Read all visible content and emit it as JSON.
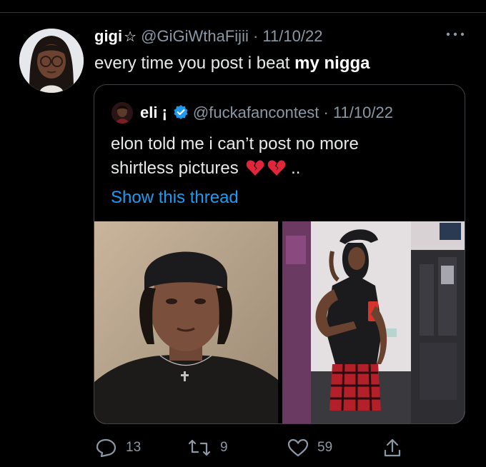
{
  "tweet": {
    "display_name": "gigi",
    "name_symbol": "☆",
    "handle": "@GiGiWthaFijii",
    "date_separator": "·",
    "date": "11/10/22",
    "text_plain": "every time you post i beat ",
    "text_bold": "my nigga",
    "more_label": "More"
  },
  "quote": {
    "display_name": "eli",
    "name_symbol": "¡",
    "handle": "@fuckafancontest",
    "date_separator": "·",
    "date": "11/10/22",
    "text_line1": "elon told me i can’t post no more",
    "text_line2": "shirtless pictures",
    "text_trailing": "..",
    "emoji": [
      "broken-heart-icon",
      "broken-heart-icon"
    ],
    "show_thread": "Show this thread"
  },
  "actions": {
    "replies": "13",
    "retweets": "9",
    "likes": "59"
  },
  "colors": {
    "background": "#000000",
    "text": "#e7e9ea",
    "secondary": "#8b98a5",
    "link": "#1d9bf0",
    "verified": "#1d9bf0",
    "border": "#3e4347",
    "broken_heart": "#e0263b"
  }
}
